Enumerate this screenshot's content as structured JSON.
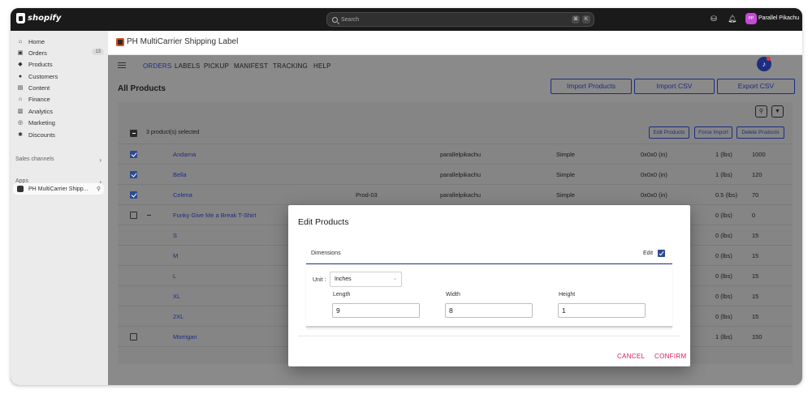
{
  "topbar": {
    "brand": "shopify",
    "search_placeholder": "Search",
    "shortcut_keys": [
      "⌘",
      "K"
    ],
    "avatar_initials": "PP",
    "store_name": "Parallel Pikachu"
  },
  "sidebar": {
    "items": [
      {
        "label": "Home",
        "icon": "home-icon"
      },
      {
        "label": "Orders",
        "icon": "orders-icon",
        "badge": "13"
      },
      {
        "label": "Products",
        "icon": "tag-icon"
      },
      {
        "label": "Customers",
        "icon": "person-icon"
      },
      {
        "label": "Content",
        "icon": "content-icon"
      },
      {
        "label": "Finance",
        "icon": "bank-icon"
      },
      {
        "label": "Analytics",
        "icon": "bar-chart-icon"
      },
      {
        "label": "Marketing",
        "icon": "target-icon"
      },
      {
        "label": "Discounts",
        "icon": "discount-icon"
      }
    ],
    "sales_channels_label": "Sales channels",
    "apps_label": "Apps",
    "app_item_label": "PH MultiCarrier Shipp..."
  },
  "app": {
    "title": "PH MultiCarrier Shipping Label",
    "menu": [
      "ORDERS",
      "LABELS",
      "PICKUP",
      "MANIFEST",
      "TRACKING",
      "HELP"
    ],
    "page_title": "All Products",
    "buttons": {
      "import_products": "Import Products",
      "import_csv": "Import CSV",
      "export_csv": "Export CSV"
    },
    "table": {
      "selected_text": "3 product(s) selected",
      "actions": {
        "edit": "Edit Products",
        "force_import": "Force Import",
        "delete": "Delete Products"
      },
      "rows": [
        {
          "checked": true,
          "name": "Andarna",
          "sku": "",
          "vendor": "parallelpikachu",
          "type": "Simple",
          "dims": "0x0x0 (in)",
          "weight": "1 (lbs)",
          "qty": "1000"
        },
        {
          "checked": true,
          "name": "Bella",
          "sku": "",
          "vendor": "parallelpikachu",
          "type": "Simple",
          "dims": "0x0x0 (in)",
          "weight": "1 (lbs)",
          "qty": "120"
        },
        {
          "checked": true,
          "name": "Celena",
          "sku": "Prod-03",
          "vendor": "parallelpikachu",
          "type": "Simple",
          "dims": "0x0x0 (in)",
          "weight": "0.5 (lbs)",
          "qty": "70"
        },
        {
          "checked": false,
          "parent": true,
          "name": "Funky Give Me a Break T-Shirt",
          "weight": "0 (lbs)",
          "qty": "0"
        },
        {
          "variant": true,
          "name": "S",
          "weight": "0 (lbs)",
          "qty": "15"
        },
        {
          "variant": true,
          "name": "M",
          "weight": "0 (lbs)",
          "qty": "15"
        },
        {
          "variant": true,
          "name": "L",
          "weight": "0 (lbs)",
          "qty": "15"
        },
        {
          "variant": true,
          "name": "XL",
          "weight": "0 (lbs)",
          "qty": "15"
        },
        {
          "variant": true,
          "name": "2XL",
          "weight": "0 (lbs)",
          "qty": "15"
        },
        {
          "checked": false,
          "name": "Morrigan",
          "weight": "1 (lbs)",
          "qty": "150"
        }
      ]
    }
  },
  "modal": {
    "title": "Edit Products",
    "dimensions_label": "Dimensions",
    "edit_label": "Edit",
    "unit_label": "Unit :",
    "unit_value": "Inches",
    "length_label": "Length",
    "length_value": "9",
    "width_label": "Width",
    "width_value": "8",
    "height_label": "Height",
    "height_value": "1",
    "cancel_label": "CANCEL",
    "confirm_label": "CONFIRM"
  }
}
